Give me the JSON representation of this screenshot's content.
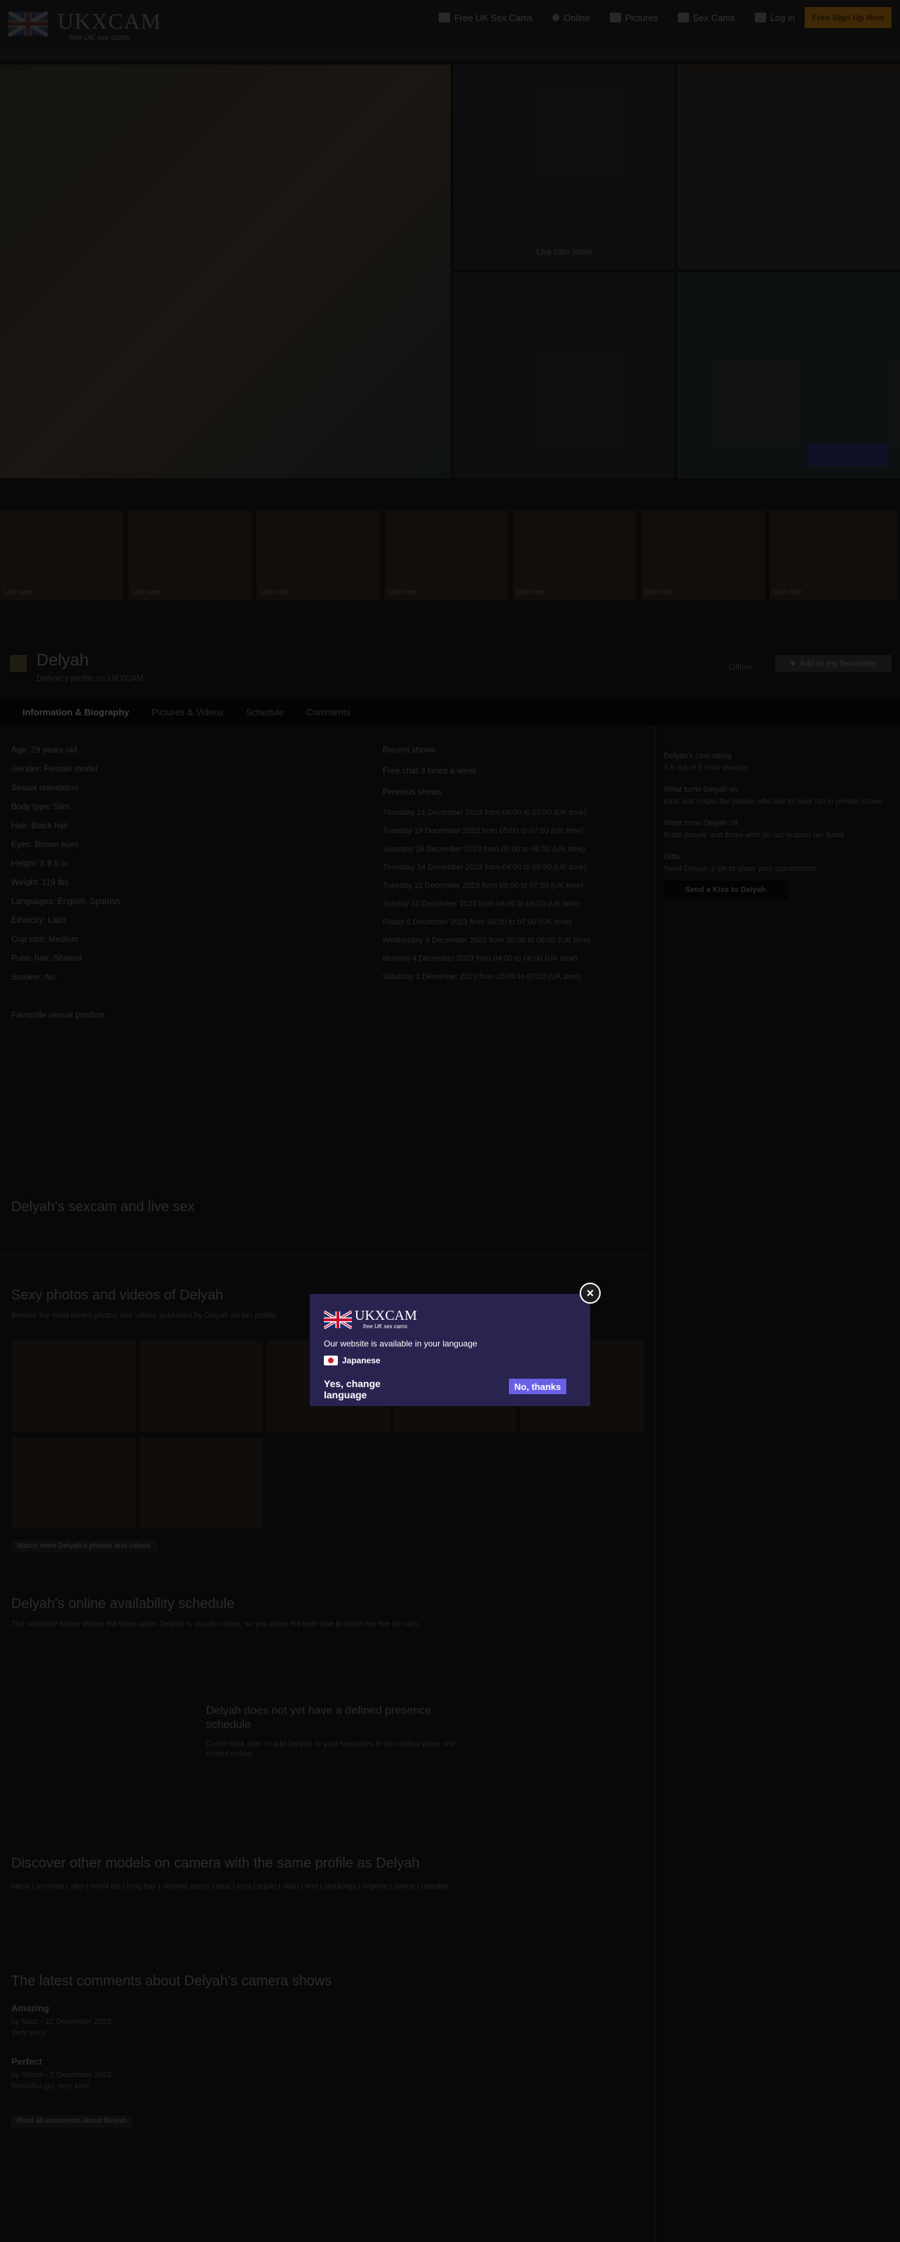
{
  "header": {
    "brand": "UKXCAM",
    "tagline": "free UK sex cams",
    "nav": [
      {
        "label": "Free UK Sex Cams",
        "icon": "camera-icon"
      },
      {
        "label": "Online",
        "icon": "live-dot-icon"
      },
      {
        "label": "Pictures",
        "icon": "picture-icon"
      },
      {
        "label": "Sex Cams",
        "icon": "cams-icon"
      },
      {
        "label": "Log in",
        "icon": "user-icon"
      }
    ],
    "cta": "Free Sign Up Now"
  },
  "hero": {
    "tile_label": "Live cam show",
    "tile_button": "Chat now"
  },
  "thumbnails": [
    "Live cam",
    "Live cam",
    "Live cam",
    "Live cam",
    "Live cam",
    "Live cam",
    "Live cam"
  ],
  "profile": {
    "name": "Delyah",
    "subtitle": "Delyah's profile on UKXCAM",
    "online_status": "Offline",
    "favourite_button": "Add to my favourites"
  },
  "tabs": [
    "Information & Biography",
    "Pictures & Videos",
    "Schedule",
    "Comments"
  ],
  "info_lines": [
    "Age: 29 years old",
    "Gender: Female model",
    "Sexual orientation",
    "Body type: Slim",
    "Hair: Black hair",
    "Eyes: Brown eyes",
    "Height: 5 ft 5 in",
    "Weight: 119 lbs",
    "Languages: English, Spanish",
    "Ethnicity: Latin",
    "Cup size: Medium",
    "Pubic hair: Shaved",
    "Smoker: No",
    "",
    "Favourite sexual position"
  ],
  "shows": {
    "title": "Recent shows",
    "summary": "Free chat 3 times a week",
    "subtitle": "Previous shows",
    "entries": [
      "Thursday 21 December 2023 from 06:00 to 07:00 (UK time)",
      "Tuesday 19 December 2023 from 05:00 to 07:00 (UK time)",
      "Saturday 16 December 2023 from 05:00 to 06:00 (UK time)",
      "Thursday 14 December 2023 from 04:00 to 06:00 (UK time)",
      "Tuesday 12 December 2023 from 05:00 to 07:00 (UK time)",
      "Sunday 10 December 2023 from 04:00 to 06:00 (UK time)",
      "Friday 8 December 2023 from 05:00 to 07:00 (UK time)",
      "Wednesday 6 December 2023 from 05:00 to 06:00 (UK time)",
      "Monday 4 December 2023 from 04:00 to 06:00 (UK time)",
      "Saturday 2 December 2023 from 05:00 to 07:00 (UK time)"
    ]
  },
  "sidebar": [
    {
      "title": "Delyah's cam rating",
      "text": "4.5 out of 5 from viewers"
    },
    {
      "title": "What turns Delyah on",
      "text": "Kind and respectful people who like to have fun in private shows"
    },
    {
      "title": "What turns Delyah off",
      "text": "Rude people and those who do not respect her limits"
    },
    {
      "title": "Gifts",
      "text": "Send Delyah a gift to show your appreciation"
    }
  ],
  "sidebar_button": "Send a Kiss to Delyah",
  "sections": {
    "sexcam": "Delyah's sexcam and live sex",
    "photos_title": "Sexy photos and videos of Delyah",
    "photos_intro": "Browse the most recent photos and videos published by Delyah on her profile.",
    "photos_link": "Watch more Delyah's photos and videos",
    "schedule_title": "Delyah's online availability schedule",
    "schedule_intro": "The schedule below shows the times when Delyah is usually online, so you know the best time to catch her live on cam.",
    "schedule_box_title": "Delyah does not yet have a defined presence schedule",
    "schedule_box_text": "Come back later or add Delyah to your favourites to be notified when she comes online.",
    "discover_title": "Discover other models on camera with the same profile as Delyah",
    "discover_text": "latina | brunette | slim | small tits | long hair | shaved pussy | anal | toys | squirt | dildo | feet | stockings | lingerie | dance | roleplay",
    "reviews_title": "The latest comments about Delyah's camera shows",
    "reviews_button": "Read all comments about Delyah"
  },
  "reviews": [
    {
      "title": "Amazing",
      "meta": "by Marc - 12 December 2023",
      "body": "Very sexy!"
    },
    {
      "title": "Perfect",
      "meta": "by Simon - 2 December 2023",
      "body": "Beautiful girl, very kind."
    }
  ],
  "modal": {
    "brand": "UKXCAM",
    "tagline": "free UK sex cams",
    "message": "Our website is available in your language",
    "language": "Japanese",
    "yes": "Yes, change language",
    "no": "No, thanks",
    "close": "×"
  },
  "colors": {
    "modal_bg": "#28234f",
    "no_button": "#6a5fe6",
    "cta": "#5a3a08"
  }
}
